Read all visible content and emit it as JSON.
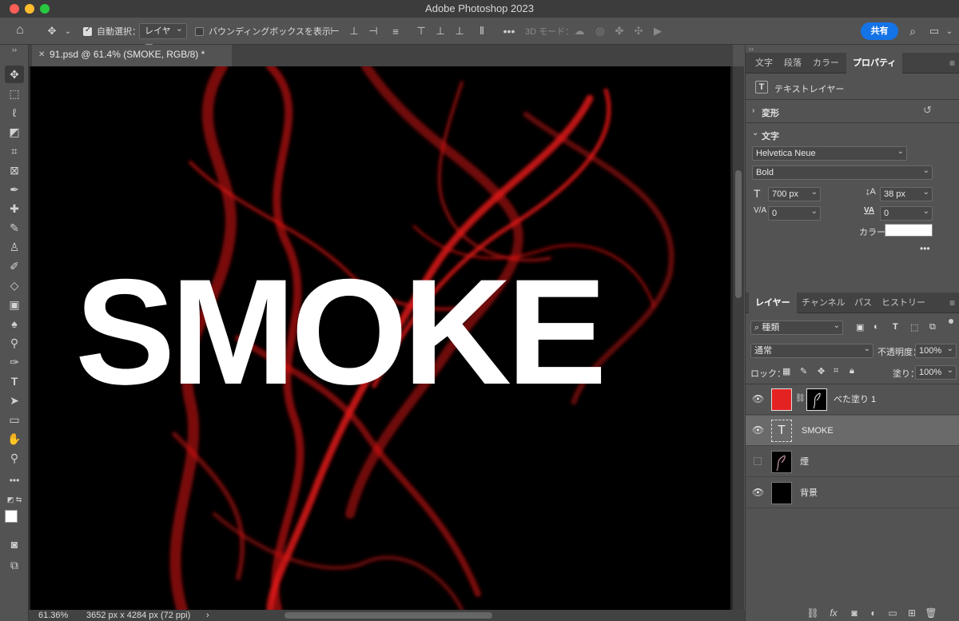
{
  "app_title": "Adobe Photoshop 2023",
  "options_bar": {
    "auto_select_label": "自動選択：",
    "auto_select_value": "レイヤー",
    "bounding_box_label": "バウンディングボックスを表示",
    "mode_3d_label": "3D モード：",
    "share_label": "共有"
  },
  "document": {
    "tab_title": "91.psd @ 61.4% (SMOKE, RGB/8) *",
    "canvas_text": "SMOKE",
    "zoom": "61.36%",
    "dimensions": "3652 px x 4284 px (72 ppi)"
  },
  "properties_panel": {
    "tabs": [
      "文字",
      "段落",
      "カラー",
      "プロパティ"
    ],
    "layer_kind": "テキストレイヤー",
    "transform_label": "変形",
    "type_label": "文字",
    "font_family": "Helvetica Neue",
    "font_style": "Bold",
    "font_size": "700 px",
    "leading": "38 px",
    "kerning": "0",
    "tracking": "0",
    "color_label": "カラー",
    "color_value": "#ffffff"
  },
  "layers_panel": {
    "tabs": [
      "レイヤー",
      "チャンネル",
      "パス",
      "ヒストリー"
    ],
    "filter_label": "種類",
    "blend_mode": "通常",
    "opacity_label": "不透明度：",
    "opacity": "100%",
    "lock_label": "ロック：",
    "fill_label": "塗り：",
    "fill": "100%",
    "layers": [
      {
        "name": "べた塗り 1",
        "visible": true
      },
      {
        "name": "SMOKE",
        "visible": true
      },
      {
        "name": "煙",
        "visible": false
      },
      {
        "name": "背景",
        "visible": true
      }
    ]
  },
  "colors": {
    "accent": "#1473e6",
    "smoke_red": "#e01414",
    "fill_red": "#e52222"
  }
}
